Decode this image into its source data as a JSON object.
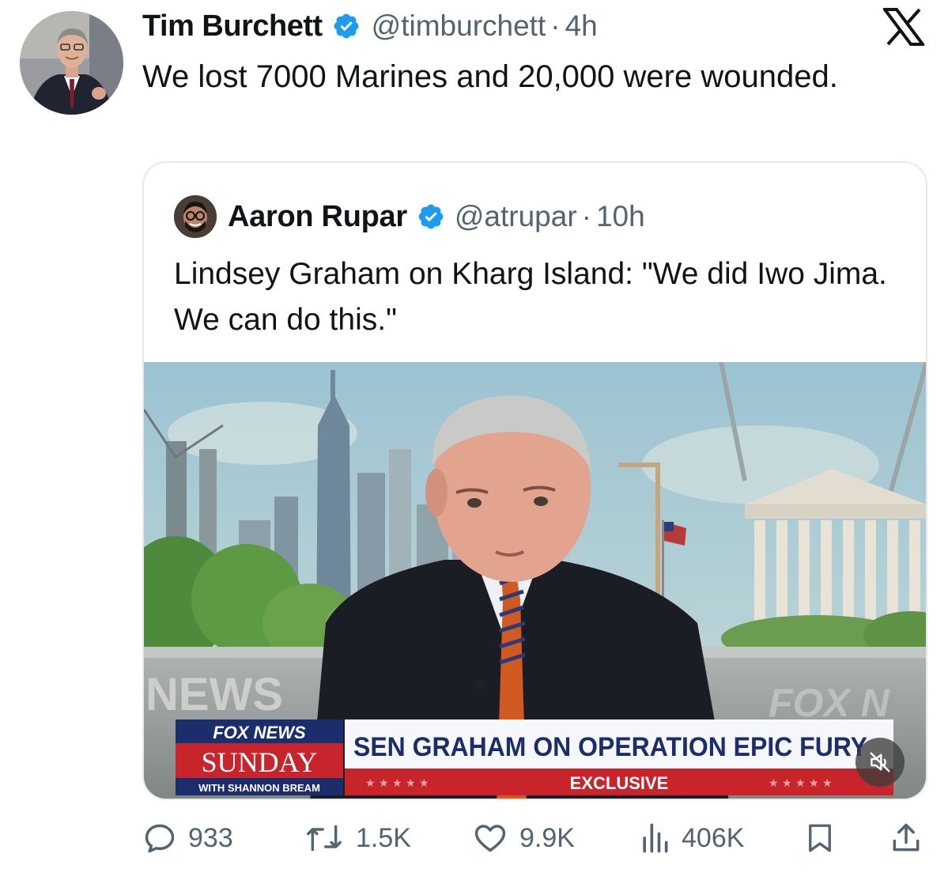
{
  "tweet": {
    "author": {
      "name": "Tim Burchett",
      "handle": "@timburchett",
      "time": "4h"
    },
    "text": "We lost 7000 Marines and 20,000 were wounded.",
    "stats": {
      "replies": "933",
      "reposts": "1.5K",
      "likes": "9.9K",
      "views": "406K"
    }
  },
  "quoted": {
    "author": {
      "name": "Aaron Rupar",
      "handle": "@atrupar",
      "time": "10h"
    },
    "text": "Lindsey Graham on Kharg Island: \"We did Iwo Jima. We can do this.\"",
    "media": {
      "bg_text": "NEWS",
      "bg_text_right": "FOX N",
      "show_logo_top": "FOX NEWS",
      "show_logo_main": "SUNDAY",
      "show_logo_host": "WITH SHANNON BREAM",
      "chyron": "SEN GRAHAM ON OPERATION EPIC FURY",
      "chyron_sub": "EXCLUSIVE"
    }
  },
  "colors": {
    "verified": "#1d9bf0",
    "secondary_text": "#536471",
    "chyron_blue": "#1c2d6b",
    "chyron_red": "#c8242b"
  },
  "icons": [
    "verified-icon",
    "x-logo-icon",
    "reply-icon",
    "repost-icon",
    "like-icon",
    "views-icon",
    "bookmark-icon",
    "share-icon",
    "muted-speaker-icon"
  ]
}
